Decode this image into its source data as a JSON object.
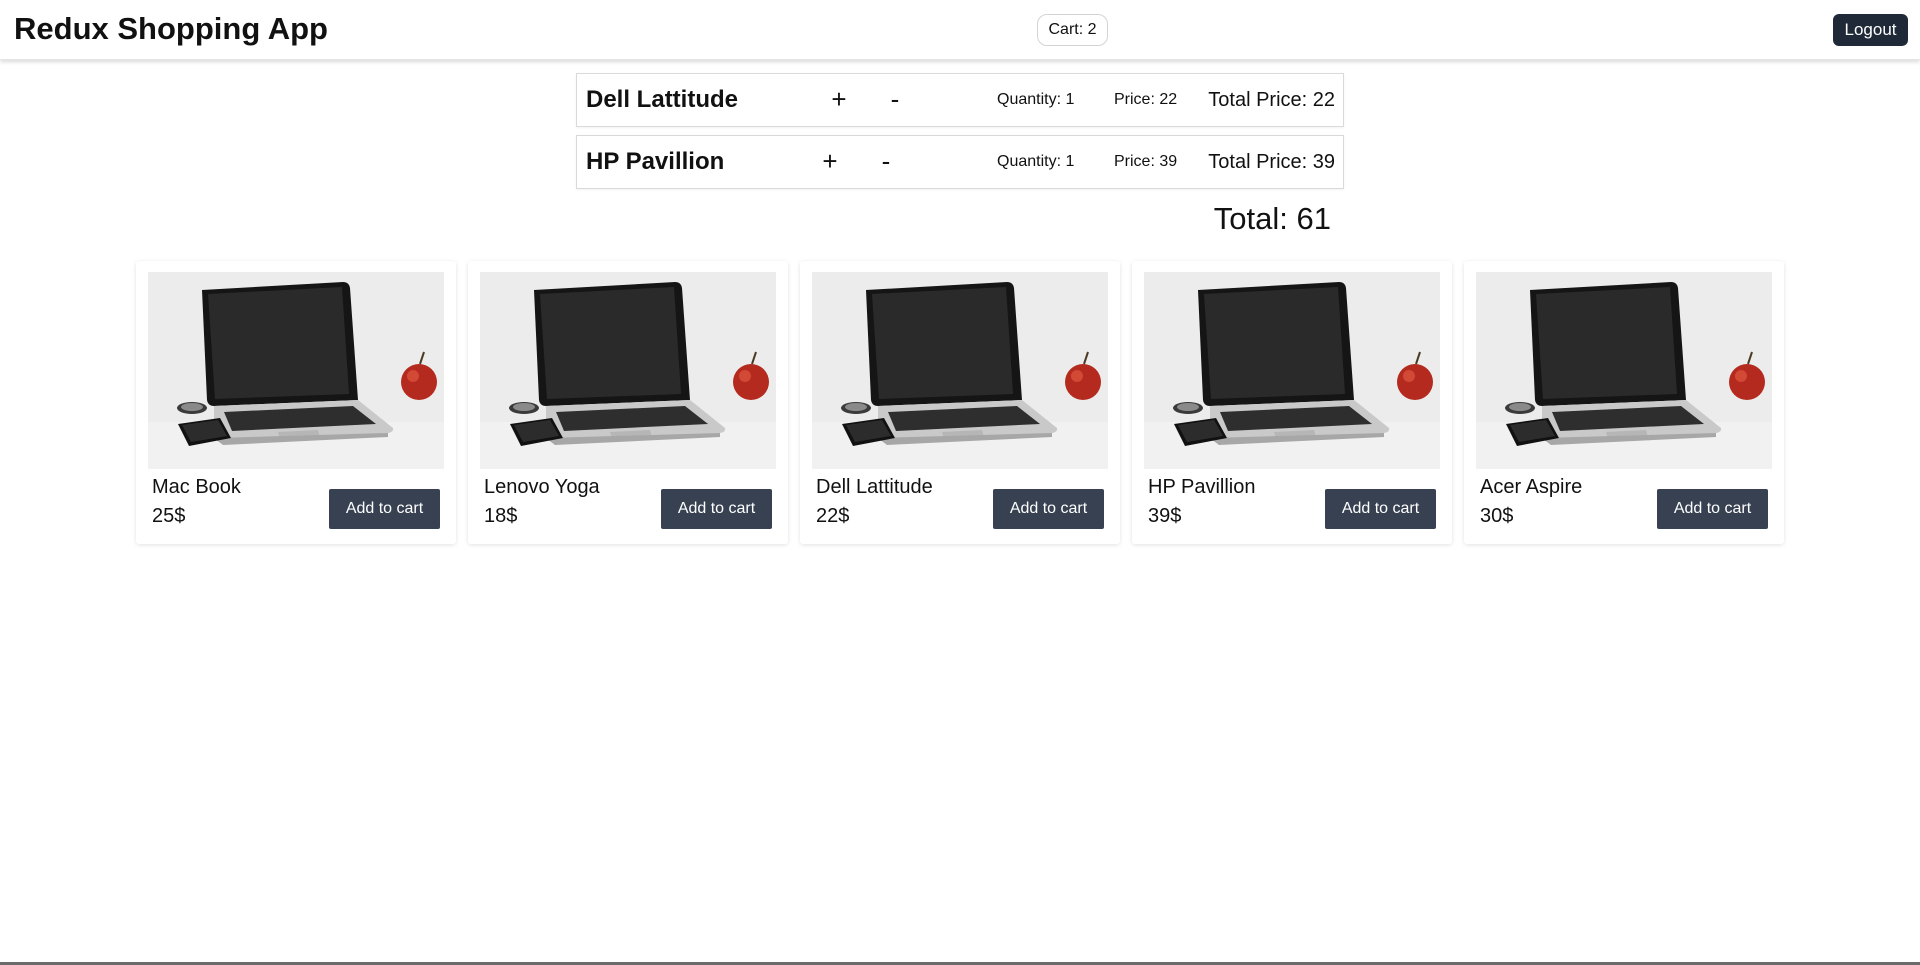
{
  "app": {
    "title": "Redux Shopping App",
    "cart_label": "Cart: 2",
    "logout_label": "Logout"
  },
  "cart": {
    "items": [
      {
        "name": "Dell Lattitude",
        "plus": "+",
        "minus": "-",
        "quantity": "Quantity: 1",
        "price": "Price: 22",
        "total": "Total Price: 22"
      },
      {
        "name": "HP Pavillion",
        "plus": "+",
        "minus": "-",
        "quantity": "Quantity: 1",
        "price": "Price: 39",
        "total": "Total Price: 39"
      }
    ],
    "grand_total": "Total: 61"
  },
  "products": [
    {
      "name": "Mac Book",
      "price": "25$",
      "button": "Add to cart"
    },
    {
      "name": "Lenovo Yoga",
      "price": "18$",
      "button": "Add to cart"
    },
    {
      "name": "Dell Lattitude",
      "price": "22$",
      "button": "Add to cart"
    },
    {
      "name": "HP Pavillion",
      "price": "39$",
      "button": "Add to cart"
    },
    {
      "name": "Acer Aspire",
      "price": "30$",
      "button": "Add to cart"
    }
  ],
  "colors": {
    "dark_button": "#374151",
    "logout_button": "#1f2937"
  }
}
